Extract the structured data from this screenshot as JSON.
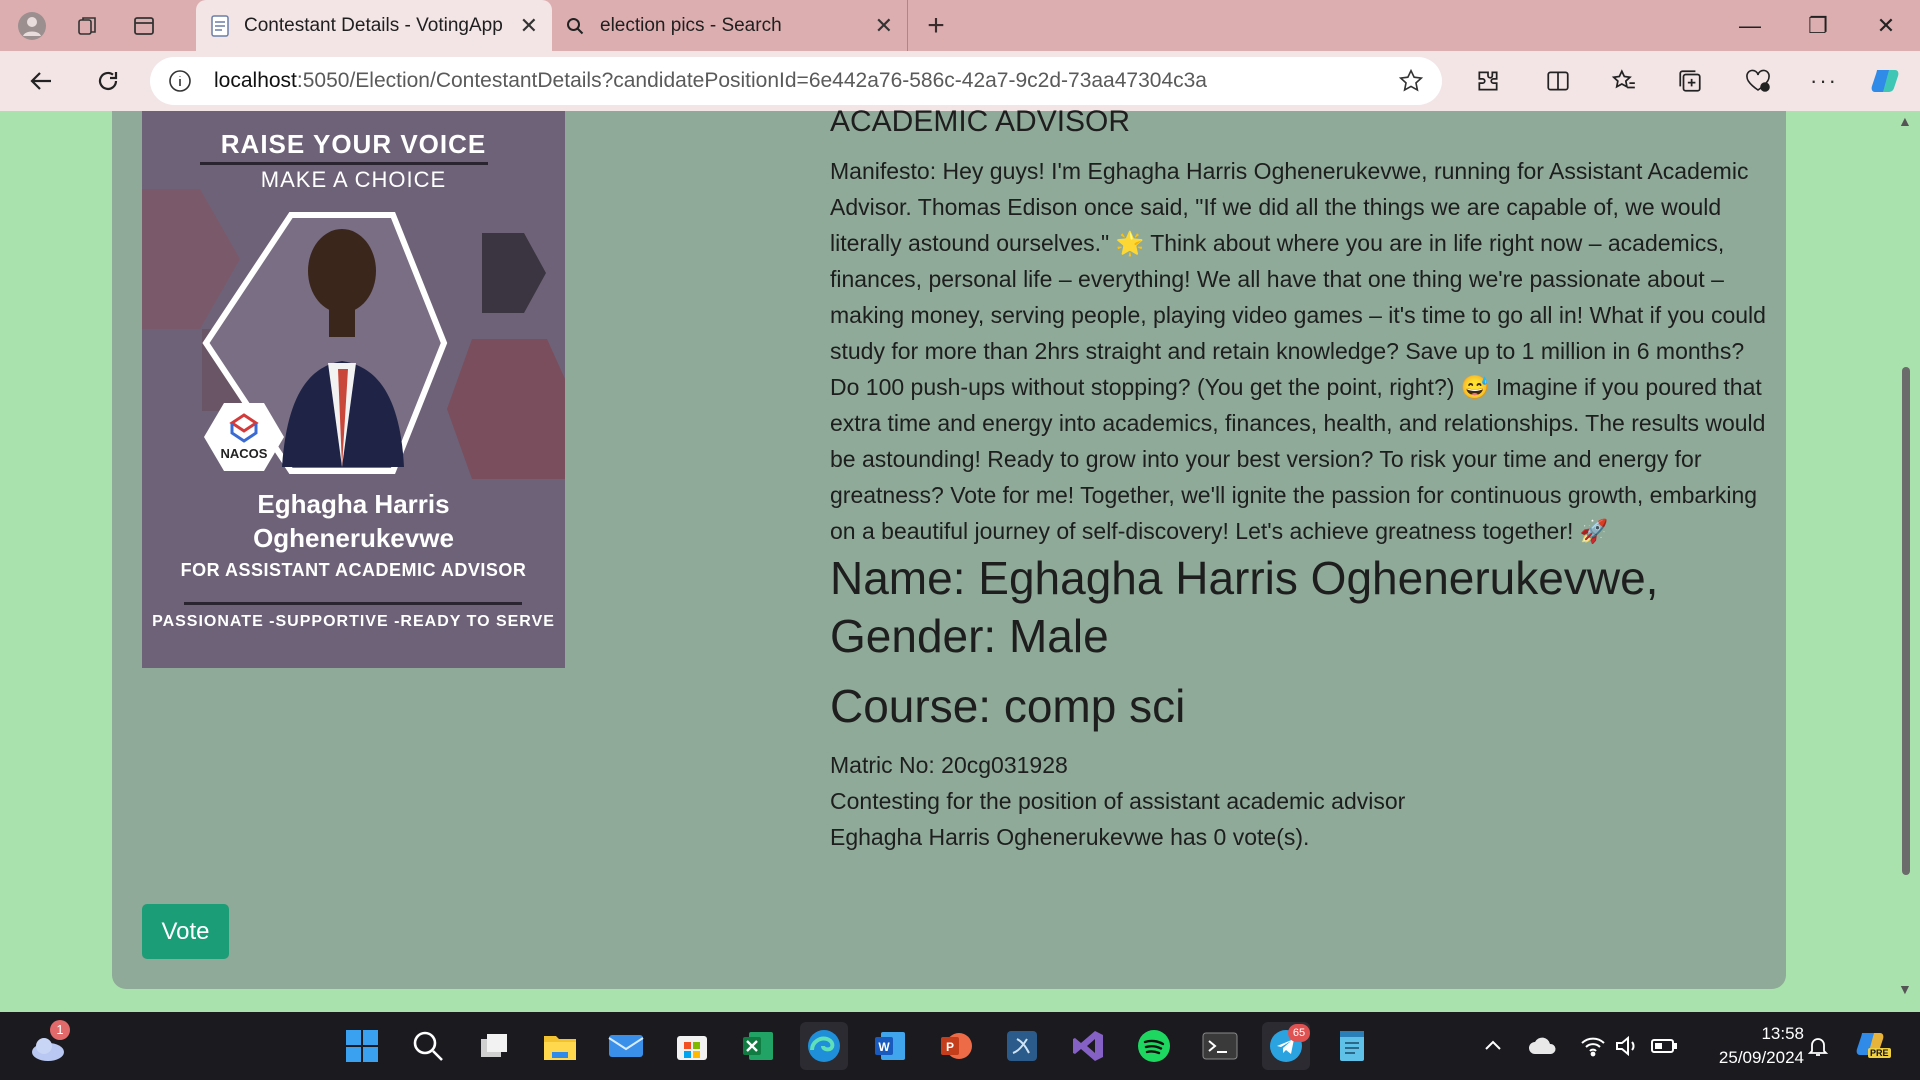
{
  "browser": {
    "tabs": [
      {
        "title": "Contestant Details - VotingApp",
        "active": true
      },
      {
        "title": "election pics - Search",
        "active": false
      }
    ],
    "address": {
      "host": "localhost",
      "rest": ":5050/Election/ContestantDetails?candidatePositionId=6e442a76-586c-42a7-9c2d-73aa47304c3a"
    }
  },
  "poster": {
    "line1": "RAISE YOUR VOICE",
    "line2": "MAKE A CHOICE",
    "logo_text": "NACOS",
    "name_line1": "Eghagha Harris",
    "name_line2": "Oghenerukevwe",
    "position": "FOR ASSISTANT ACADEMIC ADVISOR",
    "tagline": "PASSIONATE -SUPPORTIVE -READY TO SERVE"
  },
  "contestant": {
    "heading": "ACADEMIC ADVISOR",
    "manifesto": "Manifesto: Hey guys! I'm Eghagha Harris Oghenerukevwe, running for Assistant Academic Advisor. Thomas Edison once said, \"If we did all the things we are capable of, we would literally astound ourselves.\" 🌟 Think about where you are in life right now – academics, finances, personal life – everything! We all have that one thing we're passionate about – making money, serving people, playing video games – it's time to go all in! What if you could study for more than 2hrs straight and retain knowledge? Save up to 1 million in 6 months? Do 100 push-ups without stopping? (You get the point, right?) 😅 Imagine if you poured that extra time and energy into academics, finances, health, and relationships. The results would be astounding! Ready to grow into your best version? To risk your time and energy for greatness? Vote for me! Together, we'll ignite the passion for continuous growth, embarking on a beautiful journey of self-discovery! Let's achieve greatness together! 🚀",
    "name_gender": "Name: Eghagha Harris Oghenerukevwe, Gender: Male",
    "course": "Course: comp sci",
    "matric": "Matric No: 20cg031928",
    "contesting": "Contesting for the position of assistant academic advisor",
    "votes": "Eghagha Harris Oghenerukevwe has 0 vote(s)."
  },
  "vote_button": "Vote",
  "taskbar": {
    "weather_badge": "1",
    "telegram_badge": "65",
    "time": "13:58",
    "date": "25/09/2024",
    "copilot_badge": "PRE"
  },
  "colors": {
    "tab_strip": "#dcaeb0",
    "toolbar": "#f3e4e5",
    "page_bg": "#a9e2ad",
    "card": "#8faa98",
    "poster": "#6e6278",
    "vote_button": "#1b9e77",
    "taskbar": "#1b1a1f"
  }
}
